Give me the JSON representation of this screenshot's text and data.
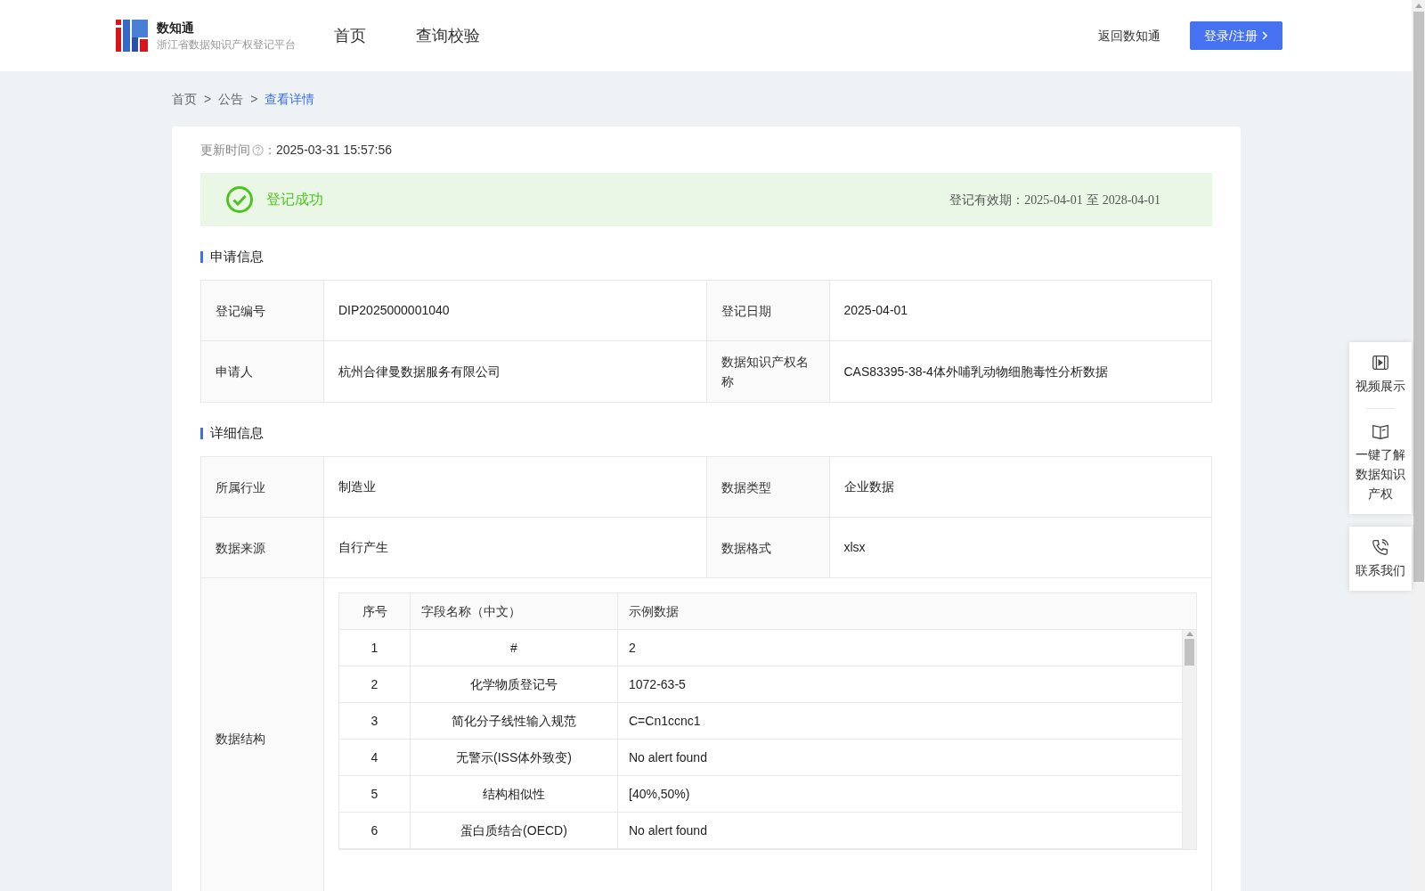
{
  "header": {
    "logo_title": "数知通",
    "logo_subtitle": "浙江省数据知识产权登记平台",
    "nav": [
      {
        "label": "首页"
      },
      {
        "label": "查询校验"
      }
    ],
    "back_link": "返回数知通",
    "login_button": "登录/注册"
  },
  "breadcrumb": [
    {
      "label": "首页",
      "selected": false
    },
    {
      "label": "公告",
      "selected": false
    },
    {
      "label": "查看详情",
      "selected": true
    }
  ],
  "breadcrumb_separator": ">",
  "update": {
    "label": "更新时间",
    "colon": "：",
    "value": "2025-03-31 15:57:56"
  },
  "status": {
    "text": "登记成功",
    "validity_label": "登记有效期：",
    "start": "2025-04-01",
    "between": "至",
    "end": "2028-04-01"
  },
  "sections": [
    {
      "title": "申请信息",
      "rows": [
        {
          "kind": "pair",
          "cells": [
            {
              "label": "登记编号",
              "value": "DIP2025000001040"
            },
            {
              "label": "登记日期",
              "value": "2025-04-01"
            }
          ]
        },
        {
          "kind": "pair",
          "cells": [
            {
              "label": "申请人",
              "value": "杭州合律曼数据服务有限公司"
            },
            {
              "label": "数据知识产权名称",
              "value": "CAS83395-38-4体外哺乳动物细胞毒性分析数据"
            }
          ]
        }
      ]
    },
    {
      "title": "详细信息",
      "rows": [
        {
          "kind": "pair",
          "cells": [
            {
              "label": "所属行业",
              "value": "制造业"
            },
            {
              "label": "数据类型",
              "value": "企业数据"
            }
          ]
        },
        {
          "kind": "pair",
          "cells": [
            {
              "label": "数据来源",
              "value": "自行产生"
            },
            {
              "label": "数据格式",
              "value": "xlsx"
            }
          ]
        },
        {
          "kind": "structure",
          "label": "数据结构",
          "columns": [
            "序号",
            "字段名称（中文）",
            "示例数据"
          ],
          "rows": [
            [
              "1",
              "#",
              "2"
            ],
            [
              "2",
              "化学物质登记号",
              "1072-63-5"
            ],
            [
              "3",
              "简化分子线性输入规范",
              "C=Cn1ccnc1"
            ],
            [
              "4",
              "无警示(ISS体外致变)",
              "No alert found"
            ],
            [
              "5",
              "结构相似性",
              "[40%,50%)"
            ],
            [
              "6",
              "蛋白质结合(OECD)",
              "No alert found"
            ]
          ]
        }
      ]
    }
  ],
  "side_panel": [
    {
      "kind": "video",
      "label": "视频展示"
    },
    {
      "kind": "book",
      "label": "一键了解数据知识产权"
    },
    {
      "kind": "phone",
      "label": "联系我们"
    }
  ]
}
